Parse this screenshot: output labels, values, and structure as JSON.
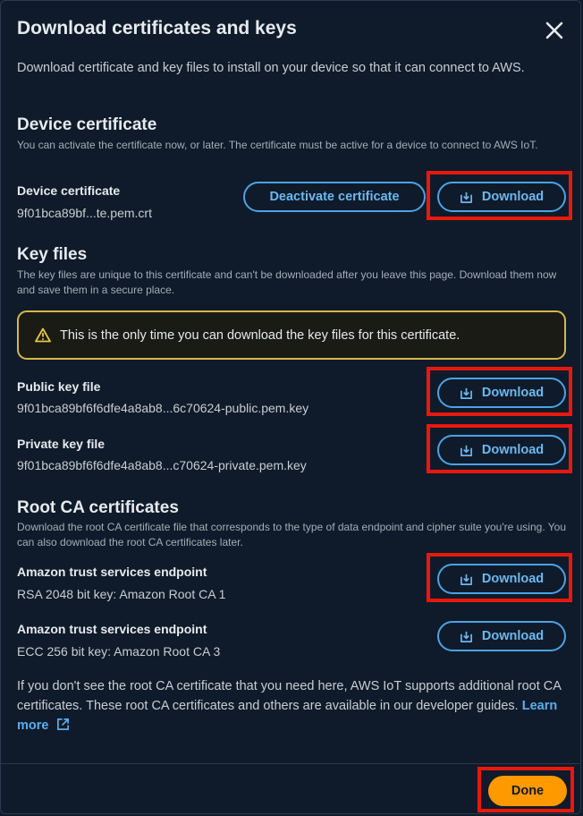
{
  "modal": {
    "title": "Download certificates and keys",
    "intro": "Download certificate and key files to install on your device so that it can connect to AWS."
  },
  "device_certificate": {
    "heading": "Device certificate",
    "description": "You can activate the certificate now, or later. The certificate must be active for a device to connect to AWS IoT.",
    "label": "Device certificate",
    "filename": "9f01bca89bf...te.pem.crt",
    "deactivate_label": "Deactivate certificate",
    "download_label": "Download"
  },
  "key_files": {
    "heading": "Key files",
    "description": "The key files are unique to this certificate and can't be downloaded after you leave this page. Download them now and save them in a secure place.",
    "alert": "This is the only time you can download the key files for this certificate.",
    "public": {
      "label": "Public key file",
      "filename": "9f01bca89bf6f6dfe4a8ab8...6c70624-public.pem.key",
      "download_label": "Download"
    },
    "private": {
      "label": "Private key file",
      "filename": "9f01bca89bf6f6dfe4a8ab8...c70624-private.pem.key",
      "download_label": "Download"
    }
  },
  "root_ca": {
    "heading": "Root CA certificates",
    "description": "Download the root CA certificate file that corresponds to the type of data endpoint and cipher suite you're using. You can also download the root CA certificates later.",
    "rsa": {
      "label": "Amazon trust services endpoint",
      "value": "RSA 2048 bit key: Amazon Root CA 1",
      "download_label": "Download"
    },
    "ecc": {
      "label": "Amazon trust services endpoint",
      "value": "ECC 256 bit key: Amazon Root CA 3",
      "download_label": "Download"
    },
    "footer": "If you don't see the root CA certificate that you need here, AWS IoT supports additional root CA certificates. These root CA certificates and others are available in our developer guides.",
    "learn_more": "Learn more"
  },
  "footer": {
    "done_label": "Done"
  },
  "colors": {
    "background": "#0f1b2a",
    "accent_blue": "#4ba3e6",
    "primary_orange": "#ff9900",
    "warning_yellow": "#d6b74a",
    "highlight_red": "#e8190b"
  },
  "icons": {
    "close": "close-icon",
    "download": "download-icon",
    "warning": "warning-icon",
    "external_link": "external-link-icon"
  }
}
